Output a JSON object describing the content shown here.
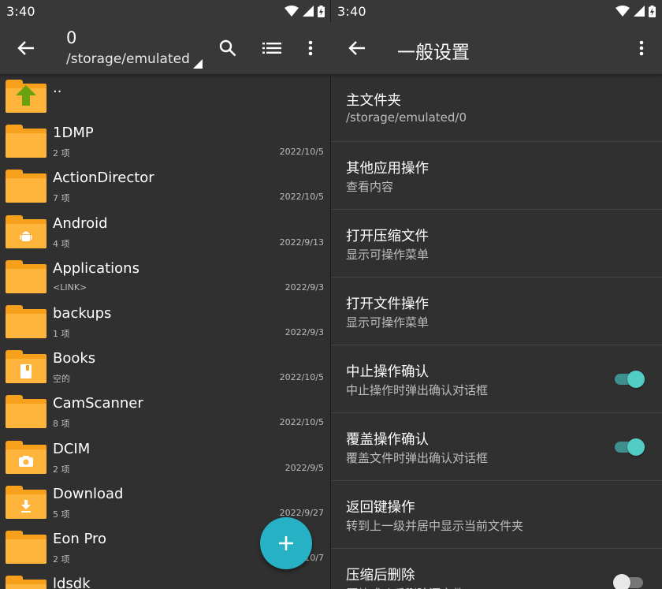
{
  "colors": {
    "accent": "#27b1c4",
    "folder": "#f7a01c",
    "toggle_on": "#52cdc5",
    "background": "#303030",
    "appbar": "#383838"
  },
  "status": {
    "time": "3:40"
  },
  "file_browser": {
    "title": "0",
    "path": "/storage/emulated",
    "icons": [
      "back-arrow-icon",
      "search-icon",
      "list-view-icon",
      "more-vert-icon"
    ],
    "parent_label": "..",
    "items": [
      {
        "name": "1DMP",
        "meta": "2 项",
        "date": "2022/10/5",
        "badge": ""
      },
      {
        "name": "ActionDirector",
        "meta": "7 项",
        "date": "2022/10/5",
        "badge": ""
      },
      {
        "name": "Android",
        "meta": "4 项",
        "date": "2022/9/13",
        "badge": "android"
      },
      {
        "name": "Applications",
        "meta": "<LINK>",
        "date": "2022/9/3",
        "badge": ""
      },
      {
        "name": "backups",
        "meta": "1 项",
        "date": "2022/9/3",
        "badge": ""
      },
      {
        "name": "Books",
        "meta": "空的",
        "date": "2022/10/5",
        "badge": "book"
      },
      {
        "name": "CamScanner",
        "meta": "8 项",
        "date": "2022/10/5",
        "badge": ""
      },
      {
        "name": "DCIM",
        "meta": "2 项",
        "date": "2022/9/5",
        "badge": "camera"
      },
      {
        "name": "Download",
        "meta": "5 项",
        "date": "2022/9/27",
        "badge": "download"
      },
      {
        "name": "Eon Pro",
        "meta": "2 项",
        "date": "2022/10/7",
        "badge": ""
      },
      {
        "name": "ldsdk",
        "meta": "",
        "date": "",
        "badge": ""
      }
    ],
    "fab_label": "+"
  },
  "settings": {
    "title": "一般设置",
    "items": [
      {
        "title": "主文件夹",
        "subtitle": "/storage/emulated/0",
        "toggle": null
      },
      {
        "title": "其他应用操作",
        "subtitle": "查看内容",
        "toggle": null
      },
      {
        "title": "打开压缩文件",
        "subtitle": "显示可操作菜单",
        "toggle": null
      },
      {
        "title": "打开文件操作",
        "subtitle": "显示可操作菜单",
        "toggle": null
      },
      {
        "title": "中止操作确认",
        "subtitle": "中止操作时弹出确认对话框",
        "toggle": true
      },
      {
        "title": "覆盖操作确认",
        "subtitle": "覆盖文件时弹出确认对话框",
        "toggle": true
      },
      {
        "title": "返回键操作",
        "subtitle": "转到上一级并居中显示当前文件夹",
        "toggle": null
      },
      {
        "title": "压缩后删除",
        "subtitle": "压缩成功后删除源文件",
        "toggle": false
      }
    ]
  }
}
